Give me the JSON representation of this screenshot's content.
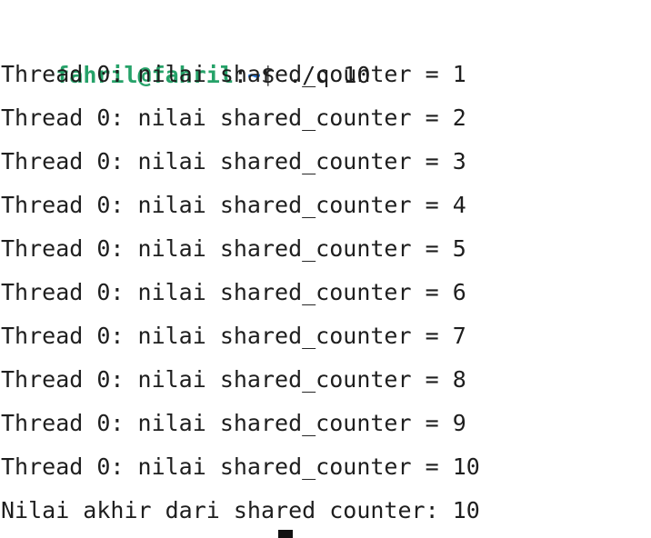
{
  "prompt": {
    "user_host": "fahril@fahril",
    "separator": ":",
    "path": "~",
    "symbol": "$ ",
    "command": "./q 10"
  },
  "output_lines": [
    "Thread 0: nilai shared_counter = 1",
    "Thread 0: nilai shared_counter = 2",
    "Thread 0: nilai shared_counter = 3",
    "Thread 0: nilai shared_counter = 4",
    "Thread 0: nilai shared_counter = 5",
    "Thread 0: nilai shared_counter = 6",
    "Thread 0: nilai shared_counter = 7",
    "Thread 0: nilai shared_counter = 8",
    "Thread 0: nilai shared_counter = 9",
    "Thread 0: nilai shared_counter = 10"
  ],
  "final_line": "Nilai akhir dari shared counter: 10",
  "colors": {
    "background": "#ffffff",
    "text": "#1e1e1e",
    "user_host": "#26a269",
    "path": "#2a7bde"
  }
}
